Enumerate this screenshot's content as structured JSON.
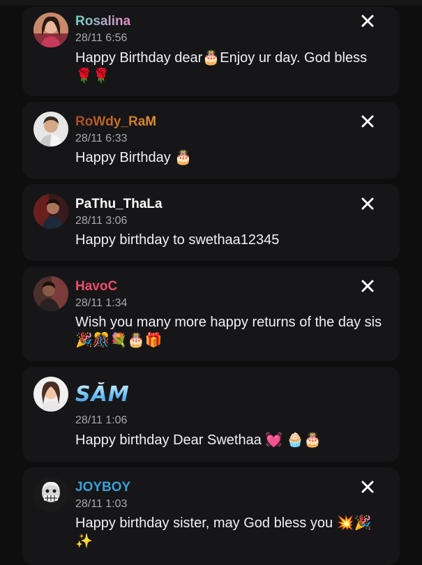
{
  "comments": [
    {
      "username": "Rosalina",
      "username_colors": [
        "#6fd3c5",
        "#e889c8"
      ],
      "timestamp": "28/11 6:56",
      "message": "Happy Birthday dear🎂Enjoy ur day. God bless 🌹🌹",
      "avatar": "avatar-rosalina"
    },
    {
      "username": "RoWdy_RaM",
      "username_colors": [
        "#b0562a",
        "#e08a2a"
      ],
      "timestamp": "28/11 6:33",
      "message": "Happy Birthday 🎂",
      "avatar": "avatar-rowdy-ram"
    },
    {
      "username": "PaThu_ThaLa",
      "username_colors": [
        "#ffffff"
      ],
      "timestamp": "28/11 3:06",
      "message": "Happy birthday to swethaa12345",
      "avatar": "avatar-pathu-thala"
    },
    {
      "username": "HavoC",
      "username_colors": [
        "#ef4d6a"
      ],
      "timestamp": "28/11 1:34",
      "message": "Wish you many more happy returns of the day sis🎉🎊💐🎂🎁",
      "avatar": "avatar-havoc"
    },
    {
      "username": "SĂM",
      "username_colors": [
        "#7cc4f2"
      ],
      "timestamp": "28/11 1:06",
      "message": "Happy birthday Dear Swethaa 💓 🧁🎂",
      "avatar": "avatar-sam"
    },
    {
      "username": "JOYBOY",
      "username_colors": [
        "#3aa0d8"
      ],
      "timestamp": "28/11 1:03",
      "message": "Happy birthday sister, may God bless you 💥🎉✨",
      "avatar": "avatar-joyboy"
    }
  ],
  "close_icon": "close-icon"
}
